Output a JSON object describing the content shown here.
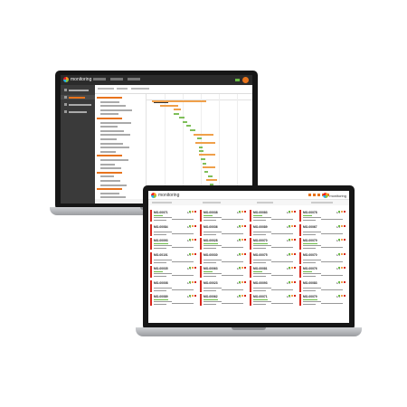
{
  "screen1": {
    "app_name": "monitoring",
    "accent": "#e8731c",
    "gantt_months": [
      "",
      ""
    ]
  },
  "screen2": {
    "app_name": "monitoring",
    "brand_name": "monitoring",
    "accent": "#e8731c",
    "card_stripe_color": "#d9261c",
    "columns": [
      {
        "cards": [
          {
            "id": "MO-00071",
            "num": "1/1"
          },
          {
            "id": "MO-00084",
            "num": "1/1"
          },
          {
            "id": "MO-00093",
            "num": "1/1"
          },
          {
            "id": "MO-00101",
            "num": "1/1"
          },
          {
            "id": "MO-00035",
            "num": "1/1"
          },
          {
            "id": "MO-00008",
            "num": "1/1"
          },
          {
            "id": "MO-00089",
            "num": "1/1"
          },
          {
            "id": "",
            "num": ""
          }
        ]
      },
      {
        "cards": [
          {
            "id": "MO-00038",
            "num": "1/1"
          },
          {
            "id": "MO-00036",
            "num": "1/1"
          },
          {
            "id": "MO-00028",
            "num": "1/1"
          },
          {
            "id": "MO-00030",
            "num": "1/1"
          },
          {
            "id": "MO-00063",
            "num": "1/1"
          },
          {
            "id": "MO-00023",
            "num": "1/1"
          },
          {
            "id": "MO-00062",
            "num": "1/1"
          },
          {
            "id": "",
            "num": ""
          }
        ]
      },
      {
        "cards": [
          {
            "id": "MO-00083",
            "num": "1/1"
          },
          {
            "id": "MO-00089",
            "num": "1/1"
          },
          {
            "id": "MO-00070",
            "num": "1/1"
          },
          {
            "id": "MO-00075",
            "num": "1/1"
          },
          {
            "id": "MO-00081",
            "num": "1/1"
          },
          {
            "id": "MO-00093",
            "num": "1/1"
          },
          {
            "id": "MO-00071",
            "num": "1/1"
          },
          {
            "id": "",
            "num": ""
          }
        ]
      },
      {
        "cards": [
          {
            "id": "MO-00078",
            "num": "1/1"
          },
          {
            "id": "MO-00067",
            "num": "1/1"
          },
          {
            "id": "MO-00079",
            "num": "1/1"
          },
          {
            "id": "MO-00070",
            "num": "1/1"
          },
          {
            "id": "MO-00076",
            "num": "1/1"
          },
          {
            "id": "MO-00083",
            "num": "1/1"
          },
          {
            "id": "MO-00079",
            "num": "1/1"
          },
          {
            "id": "",
            "num": ""
          }
        ]
      }
    ]
  }
}
